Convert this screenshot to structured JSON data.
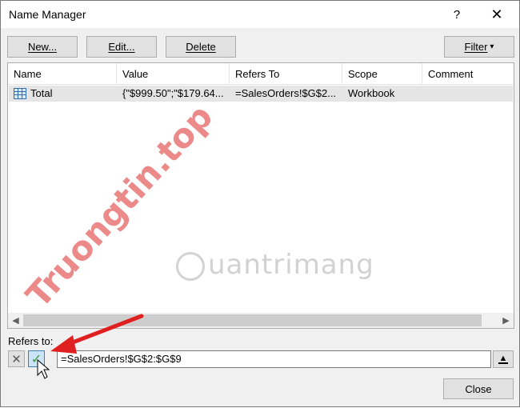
{
  "window": {
    "title": "Name Manager",
    "help_glyph": "?",
    "close_glyph": "✕"
  },
  "toolbar": {
    "new_label": "New...",
    "edit_label": "Edit...",
    "delete_label": "Delete",
    "filter_label": "Filter",
    "filter_arrow": "▾"
  },
  "table": {
    "columns": [
      "Name",
      "Value",
      "Refers To",
      "Scope",
      "Comment"
    ],
    "rows": [
      {
        "icon": "table-icon",
        "name": "Total",
        "value": "{\"$999.50\";\"$179.64...",
        "refers_to": "=SalesOrders!$G$2...",
        "scope": "Workbook",
        "comment": ""
      }
    ]
  },
  "scrollbar": {
    "left_arrow": "◀",
    "right_arrow": "▶"
  },
  "refers": {
    "label": "Refers to:",
    "cancel_glyph": "✕",
    "accept_glyph": "✓",
    "value": "=SalesOrders!$G$2:$G$9",
    "collapse_glyph": "▲"
  },
  "footer": {
    "close_label": "Close"
  },
  "watermark": {
    "logo_text": "uantrimang",
    "site_text": "Truongtin.top"
  },
  "colors": {
    "selection_row": "#e5e5e5",
    "accept_green": "#3a9a3a",
    "cancel_gray": "#5a5a5a",
    "arrow_red": "#e02020"
  }
}
